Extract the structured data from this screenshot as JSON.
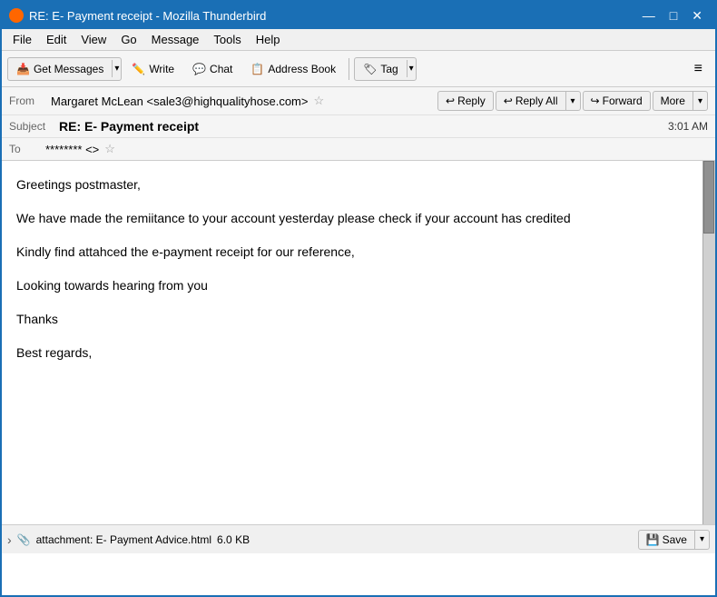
{
  "window": {
    "title": "RE: E- Payment receipt - Mozilla Thunderbird",
    "icon": "thunderbird-icon"
  },
  "titlebar": {
    "minimize": "—",
    "maximize": "□",
    "close": "✕"
  },
  "menubar": {
    "items": [
      "File",
      "Edit",
      "View",
      "Go",
      "Message",
      "Tools",
      "Help"
    ]
  },
  "toolbar": {
    "get_messages": "Get Messages",
    "write": "Write",
    "chat": "Chat",
    "address_book": "Address Book",
    "tag": "Tag",
    "tag_arrow": "▾",
    "hamburger": "≡"
  },
  "email_header": {
    "from_label": "From",
    "from_value": "Margaret McLean <sale3@highqualityhose.com>",
    "star": "☆",
    "reply": "Reply",
    "reply_all": "Reply All",
    "forward": "Forward",
    "more": "More",
    "subject_label": "Subject",
    "subject_value": "RE: E- Payment receipt",
    "timestamp": "3:01 AM",
    "to_label": "To",
    "to_value": "******** <>"
  },
  "email_body": {
    "paragraphs": [
      "Greetings postmaster,",
      "We have made the remiitance to your account yesterday please check if your account has credited",
      "Kindly find attahced the e-payment receipt for our reference,",
      "Looking towards hearing from you",
      "Thanks",
      "Best regards,"
    ]
  },
  "attachment_bar": {
    "arrow": "›",
    "label": "attachment: E- Payment Advice.html",
    "size": "6.0 KB",
    "save": "Save",
    "save_arrow": "▾"
  }
}
